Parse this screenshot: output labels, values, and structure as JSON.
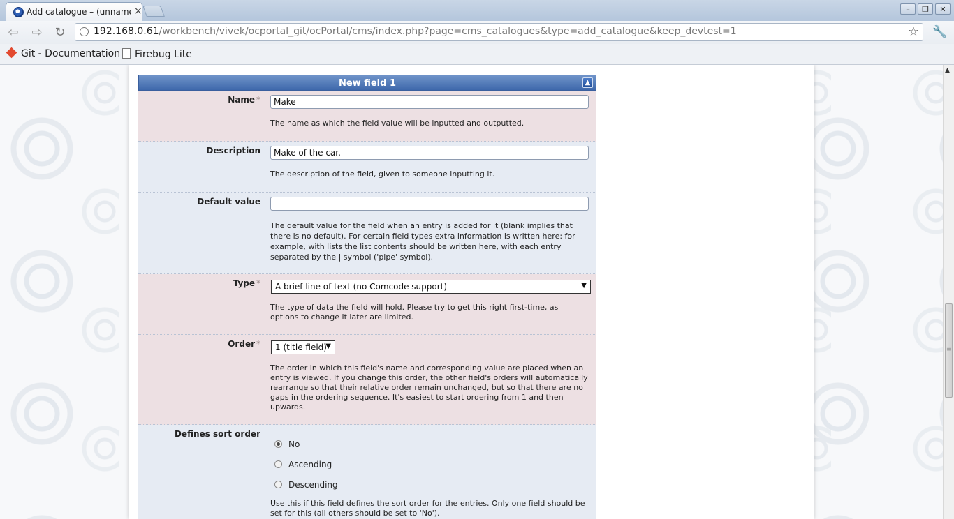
{
  "browser": {
    "tab_title": "Add catalogue – (unnamed",
    "tab_close": "×",
    "url_host": "192.168.0.61",
    "url_path": "/workbench/vivek/ocportal_git/ocPortal/cms/index.php?page=cms_catalogues&type=add_catalogue&keep_devtest=1",
    "window_buttons": [
      "–",
      "❐",
      "✕"
    ],
    "nav_icons": [
      "back-icon",
      "forward-icon",
      "reload-icon"
    ]
  },
  "bookmarks": [
    {
      "label": "Git - Documentation",
      "icon": "git-icon"
    },
    {
      "label": "Firebug Lite",
      "icon": "document-icon"
    }
  ],
  "form": {
    "section_title": "New field 1",
    "collapse_symbol": "▲",
    "name": {
      "label": "Name",
      "required_mark": "*",
      "value": "Make",
      "description": "The name as which the field value will be inputted and outputted."
    },
    "description": {
      "label": "Description",
      "value": "Make of the car.",
      "description": "The description of the field, given to someone inputting it."
    },
    "default_value": {
      "label": "Default value",
      "value": "",
      "description": "The default value for the field when an entry is added for it (blank implies that there is no default). For certain field types extra information is written here: for example, with lists the list contents should be written here, with each entry separated by the | symbol ('pipe' symbol)."
    },
    "type": {
      "label": "Type",
      "required_mark": "*",
      "selected": "A brief line of text (no Comcode support)",
      "description": "The type of data the field will hold. Please try to get this right first-time, as options to change it later are limited."
    },
    "order": {
      "label": "Order",
      "required_mark": "*",
      "selected": "1 (title field)",
      "description": "The order in which this field's name and corresponding value are placed when an entry is viewed. If you change this order, the other field's orders will automatically rearrange so that their relative order remain unchanged, but so that there are no gaps in the ordering sequence. It's easiest to start ordering from 1 and then upwards."
    },
    "sort_order": {
      "label": "Defines sort order",
      "options": [
        {
          "label": "No",
          "checked": true
        },
        {
          "label": "Ascending",
          "checked": false
        },
        {
          "label": "Descending",
          "checked": false
        }
      ],
      "description": "Use this if this field defines the sort order for the entries. Only one field should be set for this (all others should be set to 'No')."
    }
  }
}
